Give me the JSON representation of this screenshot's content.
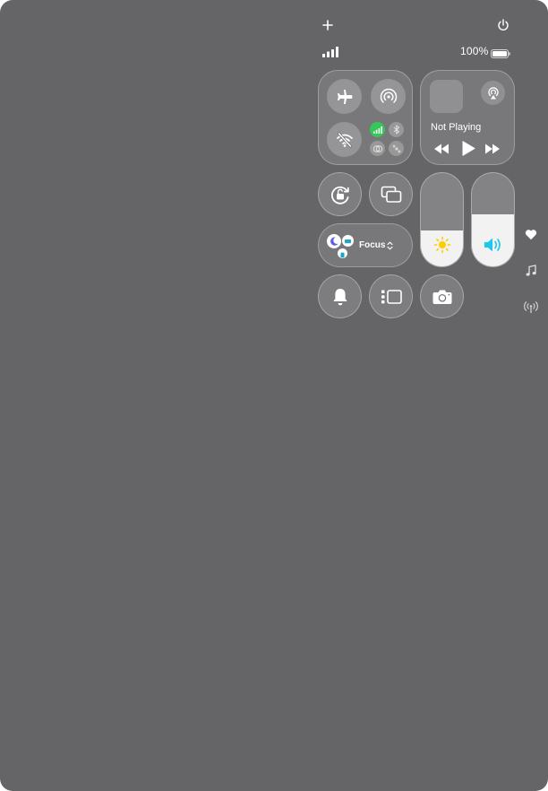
{
  "status": {
    "battery_percent": "100%",
    "battery_level": 1.0,
    "signal_bars": 4
  },
  "now_playing": {
    "label": "Not Playing"
  },
  "focus": {
    "label": "Focus"
  },
  "sliders": {
    "brightness_level": 0.38,
    "volume_level": 0.56
  },
  "icons": {
    "top": [
      "plus-icon",
      "power-icon"
    ],
    "connectivity": [
      "airplane-icon",
      "airdrop-icon",
      "wifi-off-icon",
      "cellular-icon",
      "bluetooth-off-icon",
      "vpn-icon",
      "satellite-icon"
    ],
    "media": [
      "airplay-icon",
      "rewind-icon",
      "play-icon",
      "fast-forward-icon"
    ],
    "controls": [
      "orientation-lock-icon",
      "screen-mirroring-icon",
      "moon-icon",
      "sun-icon",
      "speaker-icon",
      "bell-icon",
      "stage-manager-icon",
      "camera-icon"
    ],
    "page_indicators": [
      "heart-icon",
      "music-note-icon",
      "antenna-icon"
    ]
  },
  "colors": {
    "background": "#656567",
    "cellular_active": "#34c759",
    "volume_accent": "#1ec8ea",
    "brightness_accent": "#ffcc00"
  }
}
